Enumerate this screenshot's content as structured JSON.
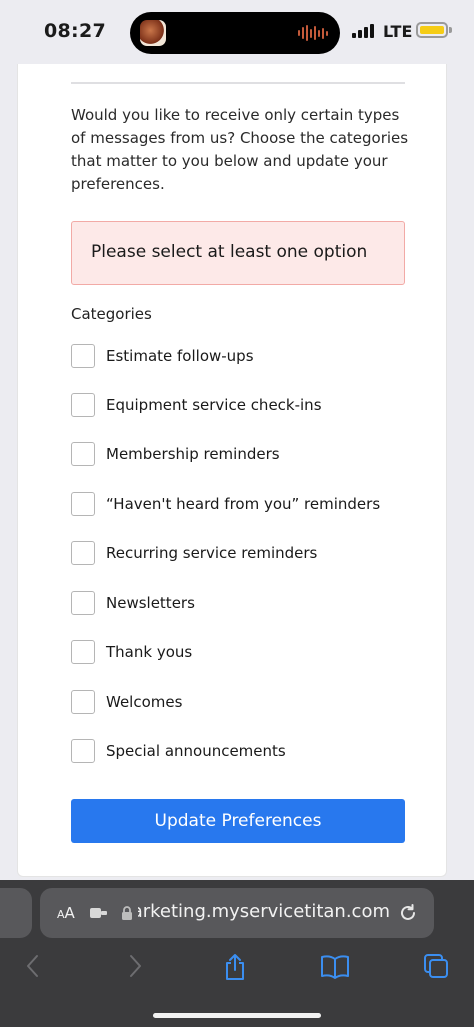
{
  "status_bar": {
    "time": "08:27",
    "network": "LTE",
    "battery_color": "#f5cc15"
  },
  "form": {
    "intro": "Would you like to receive only certain types of messages from us? Choose the categories that matter to you below and update your preferences.",
    "alert": "Please select at least one option",
    "categories_label": "Categories",
    "options": [
      "Estimate follow-ups",
      "Equipment service check-ins",
      "Membership reminders",
      "“Haven't heard from you” reminders",
      "Recurring service reminders",
      "Newsletters",
      "Thank yous",
      "Welcomes",
      "Special announcements"
    ],
    "submit_label": "Update Preferences",
    "accent_color": "#2878ee"
  },
  "browser": {
    "text_size_label": "AA",
    "url": "marketing.myservicetitan.com",
    "icons": [
      "extension-icon",
      "lock-icon",
      "reload-icon",
      "back-icon",
      "forward-icon",
      "share-icon",
      "bookmarks-icon",
      "tabs-icon"
    ]
  }
}
